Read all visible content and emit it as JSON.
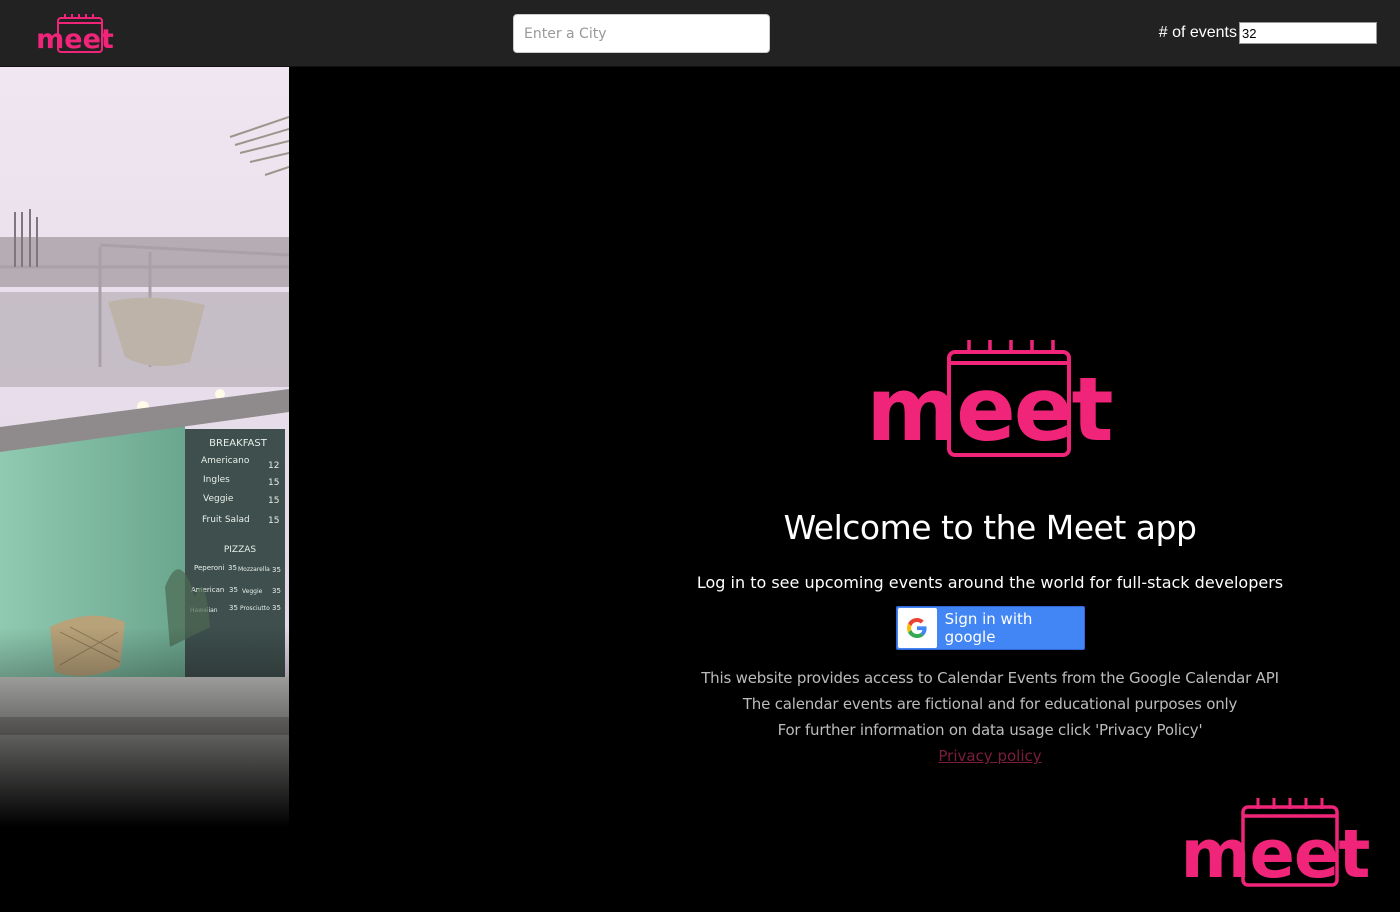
{
  "header": {
    "logo_text": "meet",
    "city_search": {
      "placeholder": "Enter a City",
      "value": ""
    },
    "events_count": {
      "label": "# of events",
      "value": "32"
    }
  },
  "welcome": {
    "logo_text": "meet",
    "title": "Welcome to the Meet app",
    "subtitle": "Log in to see upcoming events around the world for full-stack developers",
    "signin_button_label": "Sign in with google",
    "info_lines": [
      "This website provides access to Calendar Events from the Google Calendar API",
      "The calendar events are fictional and for educational purposes only",
      "For further information on data usage click 'Privacy Policy'"
    ],
    "privacy_link": "Privacy policy"
  },
  "hero_menu": {
    "heading": "BREAKFAST",
    "items": [
      {
        "name": "Americano",
        "price": "12"
      },
      {
        "name": "Ingles",
        "price": "15"
      },
      {
        "name": "Veggie",
        "price": "15"
      },
      {
        "name": "Fruit Salad",
        "price": "15"
      }
    ],
    "pizzas_heading": "PIZZAS",
    "pizzas": [
      {
        "name": "Peperoni",
        "price": "35",
        "name2": "Mozzarella",
        "price2": "35"
      },
      {
        "name": "American",
        "price": "35",
        "name2": "Veggie",
        "price2": "35"
      },
      {
        "name": "Hawaiian",
        "price": "35",
        "name2": "Prosciutto",
        "price2": "35"
      }
    ]
  },
  "corner_logo_text": "meet",
  "colors": {
    "brand_pink": "#f0257a",
    "topbar": "#222222",
    "google_blue": "#4285f4",
    "privacy_link": "#7a1d3d"
  },
  "icons": {
    "brand": "meet-calendar-logo-icon",
    "google": "google-g-icon"
  }
}
